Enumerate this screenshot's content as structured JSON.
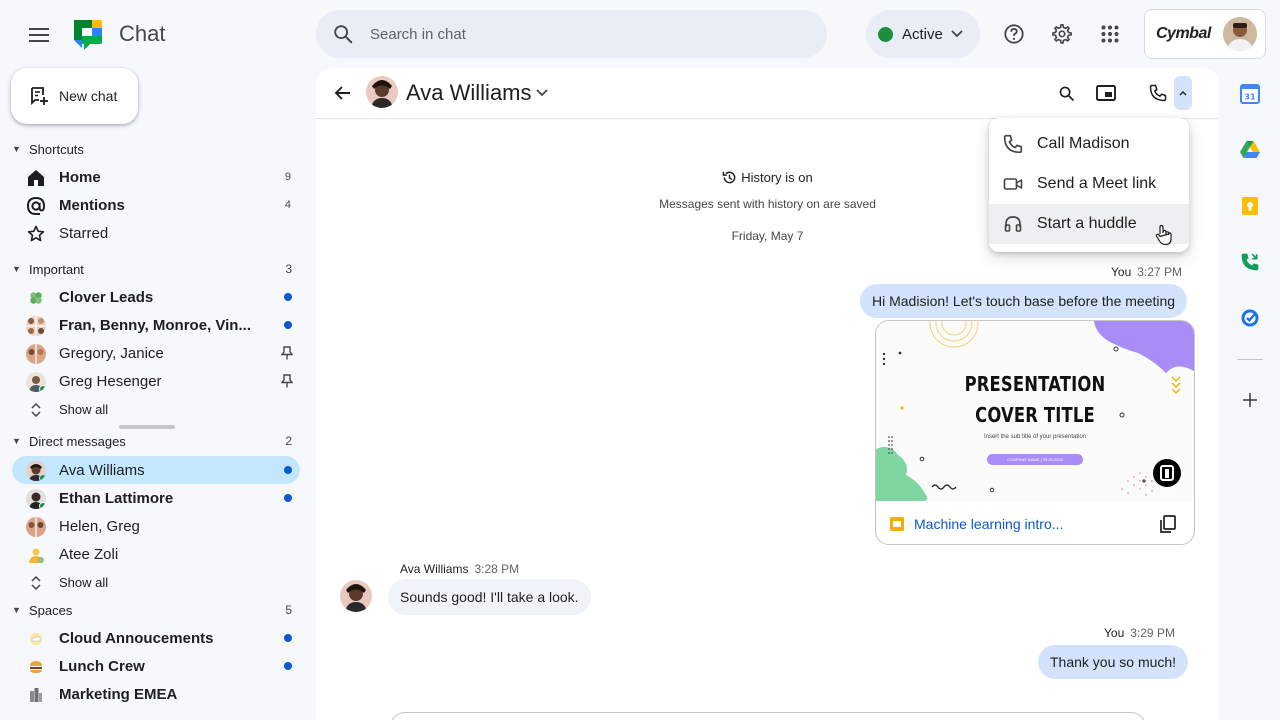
{
  "app": {
    "title": "Chat"
  },
  "search": {
    "placeholder": "Search in chat"
  },
  "status": {
    "label": "Active",
    "color": "#1e8e3e"
  },
  "brand": {
    "name": "Cymbal"
  },
  "new_chat": {
    "label": "New chat"
  },
  "sidebar": {
    "shortcuts": {
      "heading": "Shortcuts",
      "items": [
        {
          "label": "Home",
          "count": "9",
          "icon": "home-icon"
        },
        {
          "label": "Mentions",
          "count": "4",
          "icon": "at-sign-icon"
        },
        {
          "label": "Starred",
          "icon": "star-icon"
        }
      ]
    },
    "important": {
      "heading": "Important",
      "count": "3",
      "items": [
        {
          "label": "Clover Leads",
          "unread": true
        },
        {
          "label": "Fran, Benny, Monroe, Vin...",
          "unread": true
        },
        {
          "label": "Gregory, Janice",
          "pinned": true
        },
        {
          "label": "Greg Hesenger",
          "pinned": true
        }
      ],
      "show_all": "Show all"
    },
    "direct_messages": {
      "heading": "Direct messages",
      "count": "2",
      "items": [
        {
          "label": "Ava Williams",
          "unread": true,
          "selected": true
        },
        {
          "label": "Ethan Lattimore",
          "unread": true
        },
        {
          "label": "Helen, Greg"
        },
        {
          "label": "Atee Zoli"
        }
      ],
      "show_all": "Show all"
    },
    "spaces": {
      "heading": "Spaces",
      "count": "5",
      "items": [
        {
          "label": "Cloud Annoucements",
          "unread": true
        },
        {
          "label": "Lunch Crew",
          "unread": true
        },
        {
          "label": "Marketing EMEA"
        }
      ]
    }
  },
  "chat": {
    "contact_name": "Ava Williams",
    "history": {
      "title": "History is on",
      "subtitle": "Messages sent with history on are saved"
    },
    "date_separator": "Friday, May 7",
    "messages": [
      {
        "sender": "You",
        "time": "3:27 PM",
        "text": "Hi Madision! Let's touch base before the meeting"
      },
      {
        "sender": "Ava Williams",
        "time": "3:28 PM",
        "text": "Sounds good! I'll take a look."
      },
      {
        "sender": "You",
        "time": "3:29 PM",
        "text": "Thank you so much!"
      }
    ],
    "attachment": {
      "file_name": "Machine learning intro...",
      "slide_title_line1": "PRESENTATION",
      "slide_title_line2": "COVER TITLE",
      "slide_subtitle": "Insert the sub title of your presentation",
      "slide_pill": "COMPANY NAME | 00.00.2020"
    }
  },
  "call_menu": {
    "items": [
      {
        "label": "Call Madison",
        "icon": "phone-icon"
      },
      {
        "label": "Send a Meet link",
        "icon": "video-camera-icon"
      },
      {
        "label": "Start a huddle",
        "icon": "headphones-icon"
      }
    ]
  },
  "colors": {
    "accent": "#0b57d0",
    "selected_bg": "#c2e7ff",
    "bubble_out": "#d3e3fd",
    "bubble_in": "#f0f4f9"
  }
}
